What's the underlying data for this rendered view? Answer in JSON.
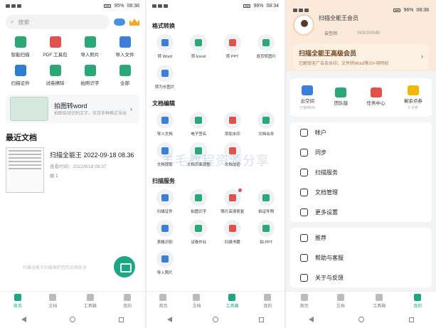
{
  "status": {
    "left_time": "08:38",
    "mid_time": "08:34",
    "right_time": "08:38",
    "left_batt": "95%",
    "mid_batt": "96%",
    "right_batt": "96%"
  },
  "home": {
    "search_placeholder": "搜索",
    "tools": [
      "智能扫描",
      "PDF 工具包",
      "导入照片",
      "导入文件",
      "扫描证件",
      "试卷擦除",
      "拍照识字",
      "全部"
    ],
    "tool_colors": [
      "#2aa876",
      "#e2524a",
      "#2aa876",
      "#3d7fd8",
      "#2a7fd4",
      "#2aa876",
      "#2aa876",
      "#2aa876"
    ],
    "promo_title": "拍图转word",
    "promo_sub": "拍图自动识别文字，支持多种格式导出",
    "recent_title": "最近文档",
    "doc_name": "扫描全能王 2022-09-18 08.36",
    "doc_time": "查看时间：2022/9/18 08:37",
    "doc_pages": "1",
    "safe_text": "扫描全能王扫描保护您的文档安全"
  },
  "tabs1": [
    "首页",
    "文档",
    "工具箱",
    "我的"
  ],
  "tools": {
    "sec1_title": "格式转换",
    "sec1": [
      "转 Word",
      "转 Excel",
      "转 PPT",
      "逐页转图片",
      "转为长图片"
    ],
    "sec2_title": "文档编辑",
    "sec2": [
      "导入文档",
      "电子签名",
      "添加水印",
      "文档合并",
      "文档提取",
      "文档页面调整",
      "文档加密"
    ],
    "sec3_title": "扫描服务",
    "sec3": [
      "扫描证件",
      "拍图识字",
      "照片高清修复",
      "拍证件照",
      "表格识别",
      "试卷作业",
      "扫描书籍",
      "拍 PPT",
      "导入照片"
    ],
    "watermark": "羊毛教程资源分享"
  },
  "tabs2": [
    "首页",
    "文档",
    "工具箱",
    "我的"
  ],
  "me": {
    "username": "扫描全能王会员",
    "badge": "云空间",
    "storage": "0KB/200MB",
    "vip_title": "扫描全能王高级会员",
    "vip_sub": "已解锁无广告去水印、文件转Word等20+项特权",
    "quick": [
      {
        "label": "云空间",
        "sub": "已使用0%"
      },
      {
        "label": "团队版",
        "sub": ""
      },
      {
        "label": "任务中心",
        "sub": ""
      },
      {
        "label": "剩余点券",
        "sub": "0 点券"
      }
    ],
    "menu1": [
      "帐户",
      "同步",
      "扫描服务",
      "文档管理",
      "更多设置"
    ],
    "menu2": [
      "推荐",
      "帮助与客服",
      "关于与反馈"
    ]
  },
  "tabs3": [
    "首页",
    "文档",
    "工具箱",
    "我的"
  ]
}
